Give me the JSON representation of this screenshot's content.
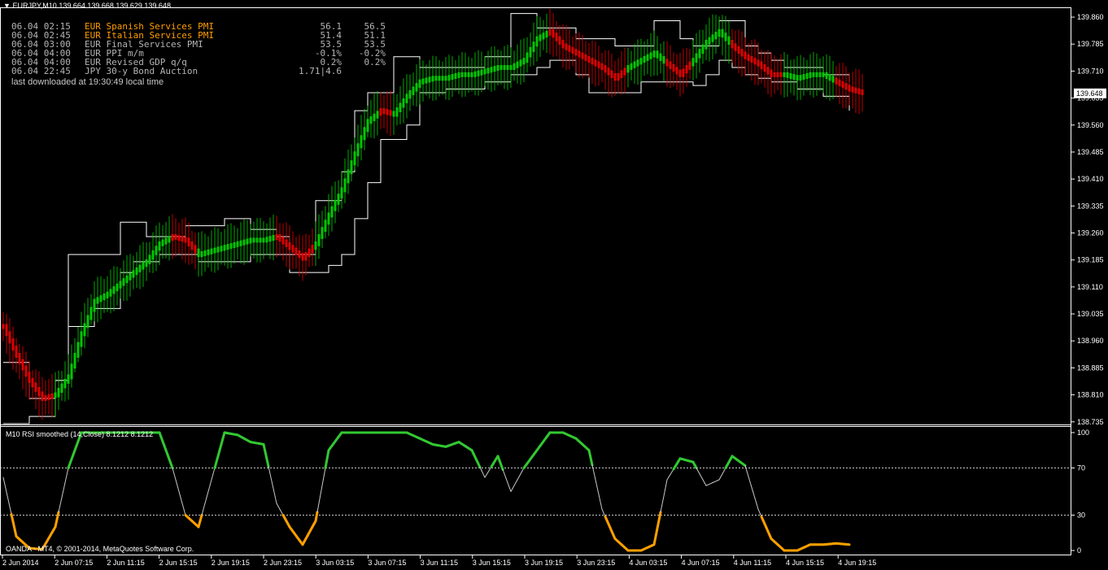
{
  "header": {
    "symbol": "EURJPY,M10",
    "ohlc": "139.664 139.668 139.629 139.648"
  },
  "news": {
    "rows": [
      {
        "time": "06.04 02:15",
        "event": "EUR Spanish Services PMI",
        "v1": "56.1",
        "v2": "56.5",
        "highlight": true
      },
      {
        "time": "06.04 02:45",
        "event": "EUR Italian Services PMI",
        "v1": "51.4",
        "v2": "51.1",
        "highlight": true
      },
      {
        "time": "06.04 03:00",
        "event": "EUR Final Services PMI",
        "v1": "53.5",
        "v2": "53.5",
        "highlight": false
      },
      {
        "time": "06.04 04:00",
        "event": "EUR PPI m/m",
        "v1": "-0.1%",
        "v2": "-0.2%",
        "highlight": false
      },
      {
        "time": "06.04 04:00",
        "event": "EUR Revised GDP q/q",
        "v1": "0.2%",
        "v2": "0.2%",
        "highlight": false
      },
      {
        "time": "06.04 22:45",
        "event": "JPY 30-y Bond Auction",
        "v1": "1.71|4.6",
        "v2": "",
        "highlight": false
      }
    ],
    "footer": "last downloaded at 19:30:49 local time"
  },
  "indicator": {
    "title": "M10 RSI smoothed (14,Close) 8.1212 8.1212"
  },
  "copyright": "OANDA - MT4, © 2001-2014, MetaQuotes Software Corp.",
  "colors": {
    "background": "#000000",
    "bull": "#00c800",
    "bear": "#e00000",
    "band": "#ffffff",
    "rsi_high": "#32c832",
    "rsi_low": "#ffa000",
    "rsi_mid": "#c8c8c8",
    "current_price_bg": "#ffffff"
  },
  "chart_data": [
    {
      "type": "line",
      "title": "",
      "price_axis_ticks": [
        "139.860",
        "139.785",
        "139.710",
        "139.635",
        "139.560",
        "139.485",
        "139.410",
        "139.335",
        "139.260",
        "139.185",
        "139.110",
        "139.035",
        "138.960",
        "138.885",
        "138.810",
        "138.735"
      ],
      "ylim": [
        138.73,
        139.885
      ],
      "current_price": "139.648",
      "time_axis_ticks": [
        "2 Jun 2014",
        "2 Jun 07:15",
        "2 Jun 11:15",
        "2 Jun 15:15",
        "2 Jun 19:15",
        "2 Jun 23:15",
        "3 Jun 03:15",
        "3 Jun 07:15",
        "3 Jun 11:15",
        "3 Jun 15:15",
        "3 Jun 19:15",
        "3 Jun 23:15",
        "4 Jun 03:15",
        "4 Jun 07:15",
        "4 Jun 11:15",
        "4 Jun 15:15",
        "4 Jun 19:15"
      ],
      "series": [
        {
          "role": "smoothed-candle-center",
          "x_index": [
            0,
            4,
            8,
            12,
            16,
            20,
            24,
            28,
            32,
            36,
            40,
            44,
            48,
            52,
            56,
            60,
            64,
            68,
            72,
            76,
            80,
            84,
            88,
            92,
            96,
            100,
            104,
            108,
            112,
            116,
            120,
            124,
            128,
            132,
            136,
            140,
            144,
            148,
            152,
            156,
            160,
            164,
            168,
            172,
            176,
            180,
            184,
            188,
            192,
            196,
            200,
            204,
            208,
            212,
            216,
            220,
            224,
            228,
            232,
            236,
            240,
            244,
            248,
            252,
            256,
            260,
            264
          ],
          "values": [
            139.0,
            138.92,
            138.85,
            138.8,
            138.81,
            138.86,
            138.98,
            139.07,
            139.09,
            139.12,
            139.15,
            139.18,
            139.23,
            139.25,
            139.24,
            139.2,
            139.21,
            139.22,
            139.23,
            139.24,
            139.24,
            139.25,
            139.22,
            139.19,
            139.23,
            139.31,
            139.38,
            139.48,
            139.57,
            139.6,
            139.59,
            139.64,
            139.68,
            139.69,
            139.69,
            139.7,
            139.7,
            139.71,
            139.72,
            139.72,
            139.74,
            139.8,
            139.82,
            139.78,
            139.76,
            139.74,
            139.72,
            139.69,
            139.72,
            139.74,
            139.76,
            139.73,
            139.7,
            139.74,
            139.79,
            139.82,
            139.78,
            139.75,
            139.73,
            139.7,
            139.7,
            139.69,
            139.7,
            139.7,
            139.68,
            139.66,
            139.65
          ],
          "direction": [
            "bear",
            "bear",
            "bear",
            "bear",
            "bull",
            "bull",
            "bull",
            "bull",
            "bull",
            "bull",
            "bull",
            "bull",
            "bull",
            "bear",
            "bear",
            "bull",
            "bull",
            "bull",
            "bull",
            "bull",
            "bull",
            "bear",
            "bear",
            "bear",
            "bull",
            "bull",
            "bull",
            "bull",
            "bull",
            "bear",
            "bull",
            "bull",
            "bull",
            "bull",
            "bull",
            "bull",
            "bull",
            "bull",
            "bull",
            "bull",
            "bull",
            "bull",
            "bear",
            "bear",
            "bear",
            "bear",
            "bear",
            "bear",
            "bull",
            "bull",
            "bull",
            "bear",
            "bear",
            "bull",
            "bull",
            "bull",
            "bear",
            "bear",
            "bear",
            "bear",
            "bull",
            "bull",
            "bull",
            "bull",
            "bear",
            "bear",
            "bear"
          ]
        },
        {
          "role": "band-upper",
          "x_index": [
            0,
            8,
            16,
            20,
            24,
            28,
            32,
            36,
            40,
            44,
            48,
            52,
            56,
            60,
            64,
            68,
            72,
            76,
            80,
            84,
            88,
            92,
            96,
            100,
            104,
            108,
            112,
            116,
            120,
            124,
            128,
            132,
            136,
            140,
            144,
            148,
            152,
            156,
            160,
            164,
            168,
            172,
            176,
            180,
            184,
            188,
            192,
            196,
            200,
            204,
            208,
            212,
            216,
            220,
            224,
            228,
            232,
            236,
            240,
            244,
            248,
            252,
            256,
            260
          ],
          "values": [
            138.9,
            138.8,
            138.85,
            139.2,
            139.2,
            139.2,
            139.2,
            139.29,
            139.29,
            139.25,
            139.25,
            139.25,
            139.28,
            139.28,
            139.28,
            139.3,
            139.3,
            139.27,
            139.27,
            139.25,
            139.2,
            139.2,
            139.35,
            139.35,
            139.43,
            139.6,
            139.65,
            139.65,
            139.75,
            139.75,
            139.72,
            139.72,
            139.72,
            139.72,
            139.72,
            139.75,
            139.75,
            139.87,
            139.87,
            139.83,
            139.83,
            139.83,
            139.8,
            139.8,
            139.8,
            139.78,
            139.78,
            139.78,
            139.85,
            139.85,
            139.8,
            139.78,
            139.78,
            139.85,
            139.85,
            139.78,
            139.76,
            139.74,
            139.72,
            139.72,
            139.72,
            139.7,
            139.7,
            139.68
          ]
        },
        {
          "role": "band-lower",
          "x_index": [
            0,
            8,
            16,
            20,
            24,
            28,
            32,
            36,
            40,
            44,
            48,
            52,
            56,
            60,
            64,
            68,
            72,
            76,
            80,
            84,
            88,
            92,
            96,
            100,
            104,
            108,
            112,
            116,
            120,
            124,
            128,
            132,
            136,
            140,
            144,
            148,
            152,
            156,
            160,
            164,
            168,
            172,
            176,
            180,
            184,
            188,
            192,
            196,
            200,
            204,
            208,
            212,
            216,
            220,
            224,
            228,
            232,
            236,
            240,
            244,
            248,
            252,
            256,
            260
          ],
          "values": [
            138.73,
            138.75,
            138.85,
            139.0,
            139.0,
            139.05,
            139.05,
            139.15,
            139.18,
            139.18,
            139.2,
            139.2,
            139.2,
            139.18,
            139.18,
            139.18,
            139.18,
            139.2,
            139.2,
            139.2,
            139.15,
            139.15,
            139.15,
            139.17,
            139.2,
            139.3,
            139.4,
            139.52,
            139.52,
            139.56,
            139.65,
            139.65,
            139.66,
            139.66,
            139.66,
            139.68,
            139.68,
            139.7,
            139.7,
            139.72,
            139.74,
            139.74,
            139.7,
            139.65,
            139.65,
            139.65,
            139.65,
            139.68,
            139.68,
            139.68,
            139.68,
            139.67,
            139.7,
            139.74,
            139.72,
            139.7,
            139.69,
            139.68,
            139.68,
            139.66,
            139.66,
            139.64,
            139.64,
            139.6
          ]
        }
      ]
    },
    {
      "type": "line",
      "title": "M10 RSI smoothed (14,Close) 8.1212 8.1212",
      "ylim": [
        0,
        100
      ],
      "levels": [
        70,
        30
      ],
      "y_ticks": [
        "100",
        "70",
        "30",
        "0"
      ],
      "series": [
        {
          "name": "RSI smoothed",
          "x_index": [
            0,
            4,
            8,
            12,
            16,
            20,
            24,
            28,
            32,
            36,
            40,
            44,
            48,
            52,
            56,
            60,
            64,
            68,
            72,
            76,
            80,
            84,
            88,
            92,
            96,
            100,
            104,
            108,
            112,
            116,
            120,
            124,
            128,
            132,
            136,
            140,
            144,
            148,
            152,
            156,
            160,
            164,
            168,
            172,
            176,
            180,
            184,
            188,
            192,
            196,
            200,
            204,
            208,
            212,
            216,
            220,
            224,
            228,
            232,
            236,
            240,
            244,
            248,
            252,
            256,
            260
          ],
          "values": [
            62,
            12,
            2,
            1,
            20,
            70,
            100,
            100,
            100,
            100,
            100,
            100,
            100,
            70,
            30,
            20,
            60,
            100,
            98,
            92,
            90,
            40,
            20,
            5,
            25,
            85,
            100,
            100,
            100,
            100,
            100,
            100,
            95,
            90,
            88,
            92,
            85,
            62,
            80,
            50,
            70,
            85,
            100,
            100,
            95,
            85,
            35,
            10,
            0,
            0,
            5,
            60,
            78,
            75,
            55,
            60,
            80,
            72,
            35,
            10,
            0,
            0,
            5,
            5,
            6,
            5
          ]
        }
      ]
    }
  ]
}
